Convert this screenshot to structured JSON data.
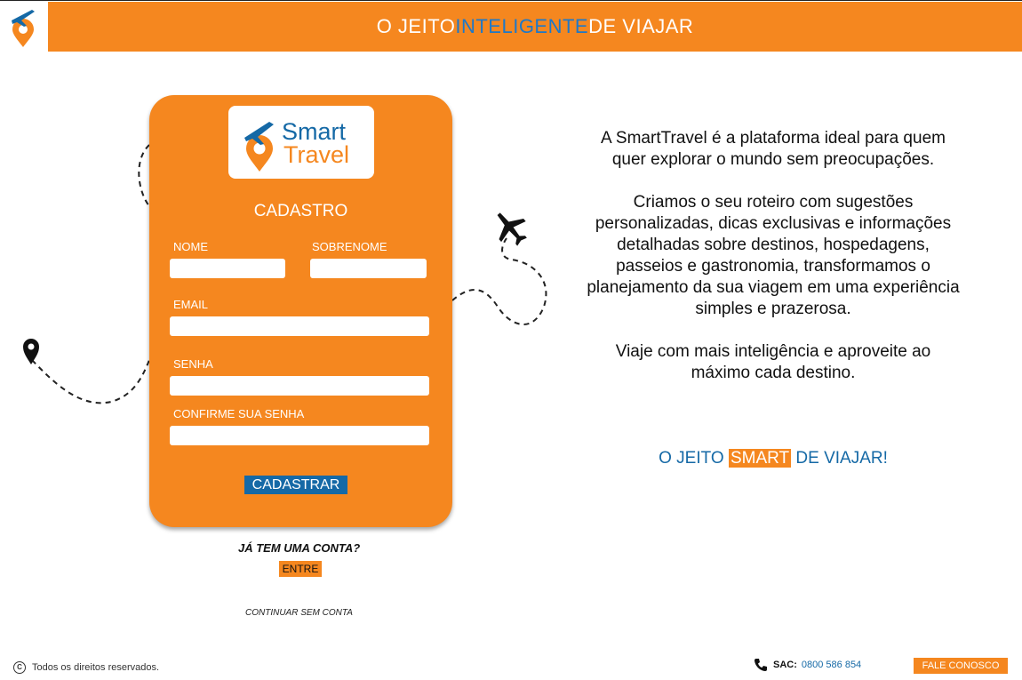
{
  "header": {
    "title_pre": "O JEITO ",
    "title_highlight": "INTELIGENTE",
    "title_post": " DE VIAJAR"
  },
  "brand": {
    "line1": "Smart",
    "line2": "Travel"
  },
  "form": {
    "title": "CADASTRO",
    "first_name_label": "NOME",
    "first_name_value": "",
    "last_name_label": "SOBRENOME",
    "last_name_value": "",
    "email_label": "EMAIL",
    "email_value": "",
    "password_label": "SENHA",
    "confirm_label": "CONFIRME SUA SENHA",
    "submit_label": "CADASTRAR"
  },
  "login": {
    "prompt": "JÁ TEM UMA CONTA?",
    "enter_label": "ENTRE",
    "guest_label": "CONTINUAR SEM CONTA"
  },
  "about": {
    "p1": "A SmartTravel é a plataforma ideal para quem quer explorar o mundo sem preocupações.",
    "p2": "Criamos o seu roteiro com sugestões personalizadas, dicas exclusivas e informações detalhadas sobre destinos, hospedagens, passeios e gastronomia, transformamos o planejamento da sua viagem em uma experiência simples e prazerosa.",
    "p3": "Viaje com mais inteligência e aproveite ao máximo cada destino.",
    "slogan_pre": "O JEITO ",
    "slogan_highlight": "SMART",
    "slogan_post": " DE VIAJAR!"
  },
  "footer": {
    "copyright_symbol": "C",
    "copyright": "Todos os direitos reservados.",
    "sac_label": "SAC:",
    "sac_number": "0800 586 854",
    "contact_label": "FALE CONOSCO"
  },
  "colors": {
    "orange": "#f5871f",
    "blue": "#1569a6",
    "highlight_blue": "#1e78c8"
  },
  "icons": [
    "airplane-pin-logo-icon",
    "airplane-icon",
    "map-pin-icon",
    "phone-icon",
    "copyright-icon"
  ]
}
